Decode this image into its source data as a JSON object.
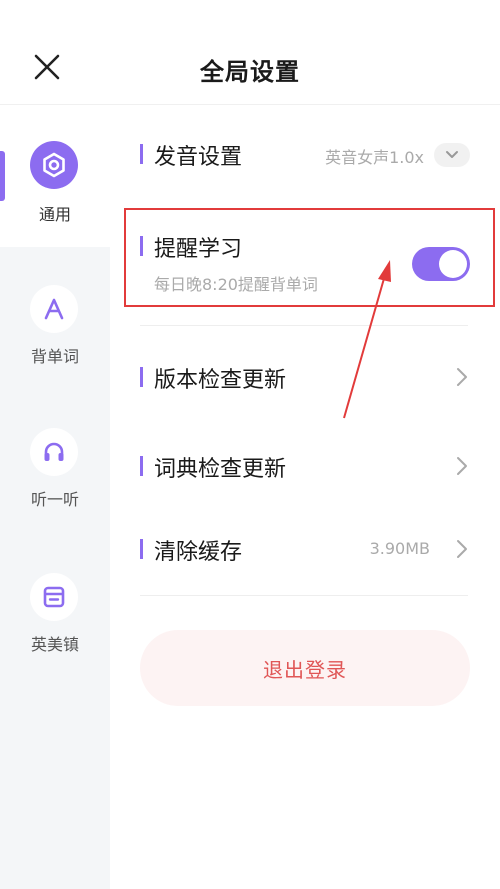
{
  "header": {
    "title": "全局设置",
    "close_icon": "close-icon"
  },
  "sidebar": {
    "items": [
      {
        "label": "通用",
        "icon": "settings-circle-icon",
        "active": true
      },
      {
        "label": "背单词",
        "icon": "letter-a-icon",
        "active": false
      },
      {
        "label": "听一听",
        "icon": "headphones-icon",
        "active": false
      },
      {
        "label": "英美镇",
        "icon": "newspaper-icon",
        "active": false
      }
    ]
  },
  "settings": {
    "pronunciation": {
      "title": "发音设置",
      "value": "英音女声1.0x"
    },
    "reminder": {
      "title": "提醒学习",
      "subtitle": "每日晚8:20提醒背单词",
      "enabled": true
    },
    "version_check": {
      "title": "版本检查更新"
    },
    "dict_check": {
      "title": "词典检查更新"
    },
    "clear_cache": {
      "title": "清除缓存",
      "value": "3.90MB"
    }
  },
  "logout": {
    "label": "退出登录"
  },
  "colors": {
    "accent": "#8c6cf0",
    "annotation": "#e23b3b",
    "logout_text": "#e05656"
  }
}
